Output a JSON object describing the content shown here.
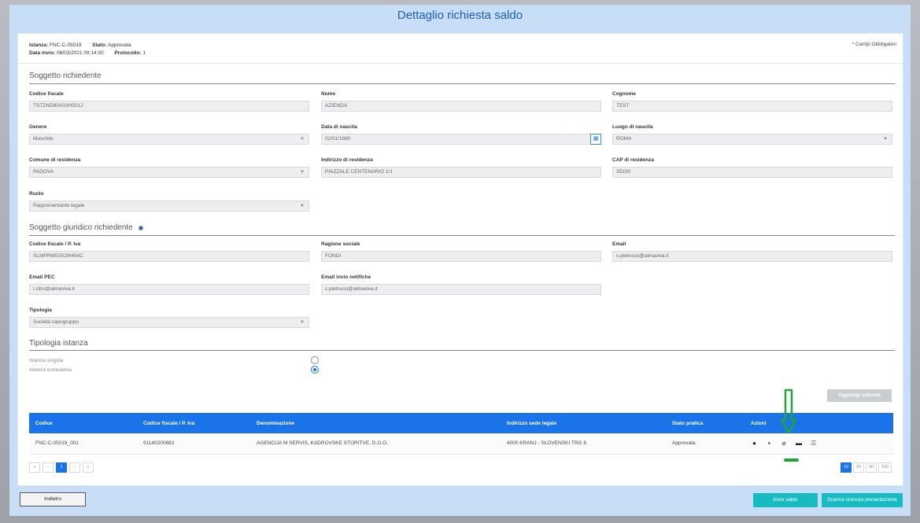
{
  "page_title": "Dettaglio richiesta saldo",
  "meta": {
    "istanza_label": "Istanza:",
    "istanza_value": "FNC-C-05019",
    "stato_label": "Stato:",
    "stato_value": "Approvata",
    "data_invio_label": "Data invio:",
    "data_invio_value": "08/03/2021 09:14:00",
    "protocollo_label": "Protocollo:",
    "protocollo_value": "1",
    "required_note": "* Campi Obbligatori"
  },
  "soggetto_richiedente": {
    "title": "Soggetto richiedente",
    "codice_fiscale": {
      "label": "Codice fiscale",
      "value": "TSTZND80A02H501J"
    },
    "nome": {
      "label": "Nome",
      "value": "AZIENDA"
    },
    "cognome": {
      "label": "Cognome",
      "value": "TEST"
    },
    "genere": {
      "label": "Genere",
      "value": "Maschile"
    },
    "data_nascita": {
      "label": "Data di nascita",
      "value": "02/01/1980"
    },
    "luogo_nascita": {
      "label": "Luogo di nascita",
      "value": "ROMA"
    },
    "comune_residenza": {
      "label": "Comune di residenza",
      "value": "PADOVA"
    },
    "indirizzo_residenza": {
      "label": "Indirizzo di residenza",
      "value": "PIAZZALE CENTENARIO 1/1"
    },
    "cap_residenza": {
      "label": "CAP di residenza",
      "value": "35100"
    },
    "ruolo": {
      "label": "Ruolo",
      "value": "Rappresentante legale"
    }
  },
  "soggetto_giuridico": {
    "title": "Soggetto giuridico richiedente",
    "codice_fiscale_piva": {
      "label": "Codice fiscale / P. Iva",
      "value": "SLMPRM53S29I454C"
    },
    "ragione_sociale": {
      "label": "Ragione sociale",
      "value": "FONDI"
    },
    "email": {
      "label": "Email",
      "value": "c.pietrucci@almaviva.it"
    },
    "email_pec": {
      "label": "Email PEC",
      "value": "l.citro@almaviva.it"
    },
    "email_notifiche": {
      "label": "Email invio notifiche",
      "value": "c.pietrucci@almaviva.it"
    },
    "tipologia": {
      "label": "Tipologia",
      "value": "Società capogruppo"
    }
  },
  "tipologia_istanza": {
    "title": "Tipologia istanza",
    "singola_label": "Istanza singola",
    "cumulativa_label": "Istanza cumulativa",
    "selected": "cumulativa"
  },
  "add_company_label": "Aggiungi azienda",
  "table": {
    "headers": [
      "Codice",
      "Codice fiscale / P. Iva",
      "Denominazione",
      "Indirizzo sede legale",
      "Stato pratica",
      "Azioni"
    ],
    "rows": [
      {
        "codice": "FNC-C-05019_001",
        "piva": "91140200683",
        "denominazione": "AGENCIJA M SERVIS, KADROVSKE STORITVE, D.O.O.",
        "indirizzo": "4000 KRANJ - SLOVENSKI TRG 8",
        "stato": "Approvata"
      }
    ],
    "action_icons": [
      "eye-icon",
      "clipboard-icon",
      "paperclip-icon",
      "folder-icon",
      "list-icon"
    ]
  },
  "pager": {
    "first": "«",
    "prev": "‹",
    "current": "1",
    "next": "›",
    "last": "»"
  },
  "page_sizes": [
    "10",
    "20",
    "50",
    "100"
  ],
  "page_size_selected": "10",
  "buttons": {
    "back": "Indietro",
    "invia": "Invia saldo",
    "scarica": "Scarica ricevuta presentazione"
  },
  "colors": {
    "primary": "#1a73e8",
    "teal": "#16bcc1",
    "annotation": "#1fa53a"
  }
}
